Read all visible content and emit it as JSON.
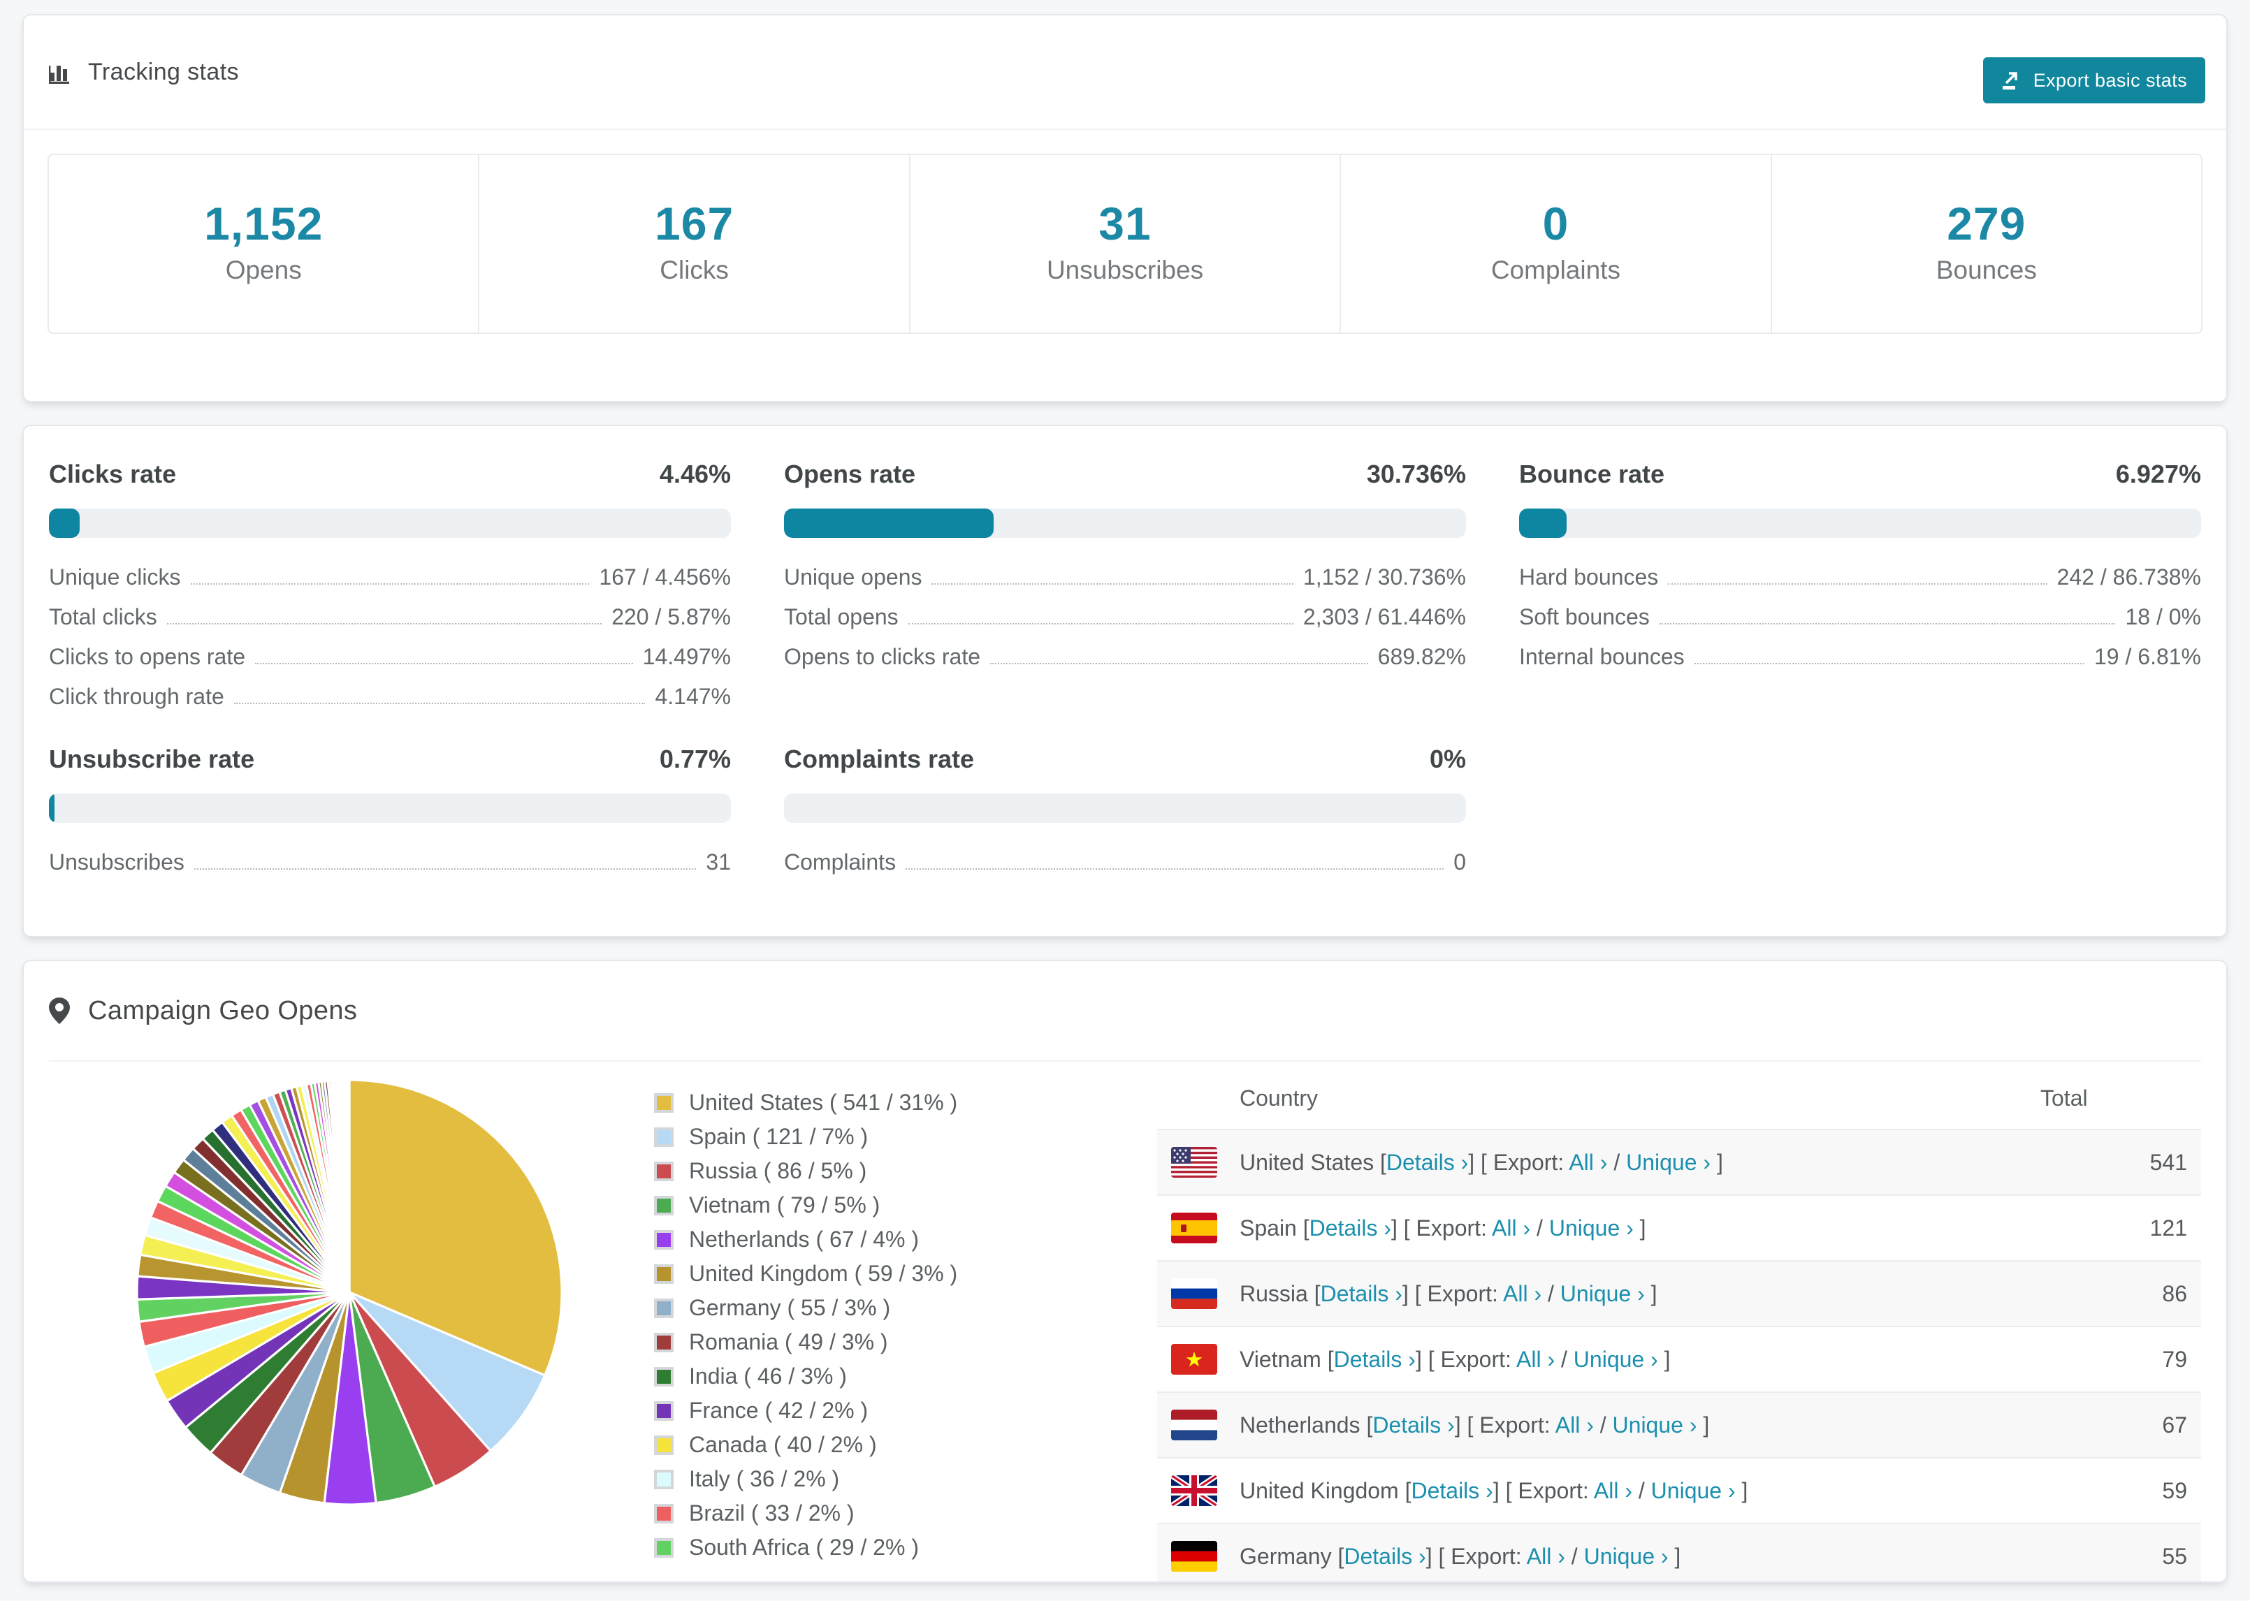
{
  "theme": {
    "accent": "#0e86a2",
    "accent_number": "#1b88a5",
    "link": "#1b8fad",
    "page_bg": "#f6f7f8"
  },
  "tracking": {
    "title": "Tracking stats",
    "title_icon": "bar-chart-icon",
    "export_button": "Export basic stats",
    "export_icon": "export-icon",
    "stats": [
      {
        "value": "1,152",
        "label": "Opens"
      },
      {
        "value": "167",
        "label": "Clicks"
      },
      {
        "value": "31",
        "label": "Unsubscribes"
      },
      {
        "value": "0",
        "label": "Complaints"
      },
      {
        "value": "279",
        "label": "Bounces"
      }
    ]
  },
  "rates": [
    {
      "title": "Clicks rate",
      "value": "4.46%",
      "percent": 4.46,
      "rows": [
        [
          "Unique clicks",
          "167 / 4.456%"
        ],
        [
          "Total clicks",
          "220 / 5.87%"
        ],
        [
          "Clicks to opens rate",
          "14.497%"
        ],
        [
          "Click through rate",
          "4.147%"
        ]
      ]
    },
    {
      "title": "Opens rate",
      "value": "30.736%",
      "percent": 30.736,
      "rows": [
        [
          "Unique opens",
          "1,152 / 30.736%"
        ],
        [
          "Total opens",
          "2,303 / 61.446%"
        ],
        [
          "Opens to clicks rate",
          "689.82%"
        ]
      ]
    },
    {
      "title": "Bounce rate",
      "value": "6.927%",
      "percent": 6.927,
      "rows": [
        [
          "Hard bounces",
          "242 / 86.738%"
        ],
        [
          "Soft bounces",
          "18 / 0%"
        ],
        [
          "Internal bounces",
          "19 / 6.81%"
        ]
      ]
    },
    {
      "title": "Unsubscribe rate",
      "value": "0.77%",
      "percent": 0.77,
      "rows": [
        [
          "Unsubscribes",
          "31"
        ]
      ]
    },
    {
      "title": "Complaints rate",
      "value": "0%",
      "percent": 0,
      "rows": [
        [
          "Complaints",
          "0"
        ]
      ]
    }
  ],
  "geo": {
    "title": "Campaign Geo Opens",
    "title_icon": "map-pin-icon",
    "punct": {
      "open": "[",
      "close": "]",
      "slash": "/",
      "export_label": "Export:"
    },
    "links": {
      "details": "Details ›",
      "all": "All ›",
      "unique": "Unique ›"
    },
    "table": {
      "columns": [
        "Country",
        "Total"
      ],
      "rows": [
        {
          "country": "United States",
          "flag": "us",
          "total": "541"
        },
        {
          "country": "Spain",
          "flag": "es",
          "total": "121"
        },
        {
          "country": "Russia",
          "flag": "ru",
          "total": "86"
        },
        {
          "country": "Vietnam",
          "flag": "vn",
          "total": "79"
        },
        {
          "country": "Netherlands",
          "flag": "nl",
          "total": "67"
        },
        {
          "country": "United Kingdom",
          "flag": "gb",
          "total": "59"
        },
        {
          "country": "Germany",
          "flag": "de",
          "total": "55"
        }
      ]
    }
  },
  "chart_data": {
    "type": "pie",
    "title": "Campaign Geo Opens",
    "legend_position": "right",
    "start_angle_deg": 0,
    "direction": "clockwise",
    "slices": [
      {
        "label": "United States",
        "value": 541,
        "pct": "31%",
        "color": "#e3bd3f",
        "legend": "United States ( 541 / 31% )"
      },
      {
        "label": "Spain",
        "value": 121,
        "pct": "7%",
        "color": "#b6d9f5",
        "legend": "Spain ( 121 / 7% )"
      },
      {
        "label": "Russia",
        "value": 86,
        "pct": "5%",
        "color": "#cb4b4e",
        "legend": "Russia ( 86 / 5% )"
      },
      {
        "label": "Vietnam",
        "value": 79,
        "pct": "5%",
        "color": "#4cab50",
        "legend": "Vietnam ( 79 / 5% )"
      },
      {
        "label": "Netherlands",
        "value": 67,
        "pct": "4%",
        "color": "#9a3ff0",
        "legend": "Netherlands ( 67 / 4% )"
      },
      {
        "label": "United Kingdom",
        "value": 59,
        "pct": "3%",
        "color": "#b6932c",
        "legend": "United Kingdom ( 59 / 3% )"
      },
      {
        "label": "Germany",
        "value": 55,
        "pct": "3%",
        "color": "#90b0ca",
        "legend": "Germany ( 55 / 3% )"
      },
      {
        "label": "Romania",
        "value": 49,
        "pct": "3%",
        "color": "#a03c3c",
        "legend": "Romania ( 49 / 3% )"
      },
      {
        "label": "India",
        "value": 46,
        "pct": "3%",
        "color": "#2f7d33",
        "legend": "India ( 46 / 3% )"
      },
      {
        "label": "France",
        "value": 42,
        "pct": "2%",
        "color": "#7434b8",
        "legend": "France ( 42 / 2% )"
      },
      {
        "label": "Canada",
        "value": 40,
        "pct": "2%",
        "color": "#f6e33c",
        "legend": "Canada ( 40 / 2% )"
      },
      {
        "label": "Italy",
        "value": 36,
        "pct": "2%",
        "color": "#dcfbff",
        "legend": "Italy ( 36 / 2% )"
      },
      {
        "label": "Brazil",
        "value": 33,
        "pct": "2%",
        "color": "#f05f5f",
        "legend": "Brazil ( 33 / 2% )"
      },
      {
        "label": "South Africa",
        "value": 29,
        "pct": "2%",
        "color": "#61d261",
        "legend": "South Africa ( 29 / 2% )"
      }
    ],
    "others_estimated_values": [
      30,
      28,
      26,
      24,
      23,
      22,
      21,
      20,
      19,
      18,
      17,
      16,
      15,
      14,
      13,
      12,
      11,
      10,
      9,
      8,
      8,
      7,
      7,
      6,
      6,
      5,
      5,
      4,
      4,
      4,
      3,
      3,
      3,
      3,
      2,
      2,
      2,
      2,
      2,
      1,
      1,
      1,
      1,
      1,
      1
    ],
    "others_color_cycle": [
      "#7a35c2",
      "#b99530",
      "#f4ef52",
      "#e6fbfd",
      "#f26464",
      "#5cd65c",
      "#d24fe0",
      "#79701f",
      "#5d7f99",
      "#82302f",
      "#27702f",
      "#2f2f7d",
      "#f4ef52",
      "#f26464",
      "#5cd65c",
      "#a54fe0",
      "#c9a433",
      "#aed5f2",
      "#cd4f52",
      "#4fae52"
    ]
  }
}
